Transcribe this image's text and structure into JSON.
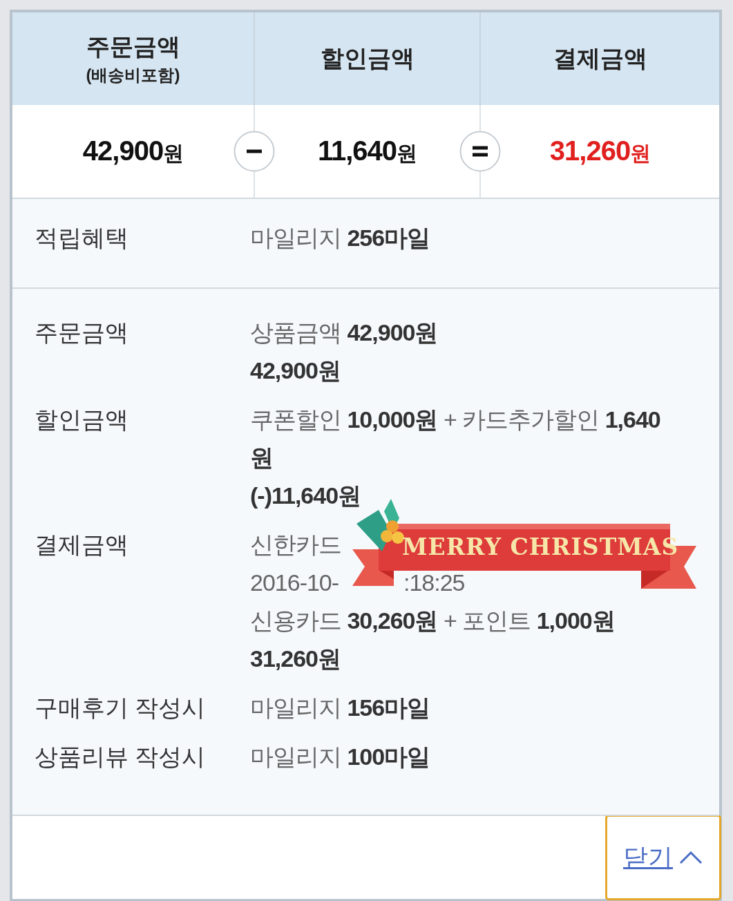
{
  "summary": {
    "columns": [
      {
        "title": "주문금액",
        "subtitle": "(배송비포함)",
        "amount": "42,900",
        "unit": "원",
        "kind": "normal"
      },
      {
        "title": "할인금액",
        "amount": "11,640",
        "unit": "원",
        "kind": "normal"
      },
      {
        "title": "결제금액",
        "amount": "31,260",
        "unit": "원",
        "kind": "total"
      }
    ],
    "operators": [
      {
        "kind": "minus"
      },
      {
        "kind": "equals"
      }
    ]
  },
  "benefit": {
    "label": "적립혜택",
    "lines": [
      "마일리지 **256마일**"
    ]
  },
  "details": [
    {
      "label": "주문금액",
      "lines": [
        "상품금액 **42,900원**",
        "**42,900원**"
      ]
    },
    {
      "label": "할인금액",
      "lines": [
        "쿠폰할인 **10,000원** + 카드추가할인 **1,640원**",
        "**(-)11,640원**"
      ]
    },
    {
      "label": "결제금액",
      "lines": [
        [
          "신한카드"
        ],
        [
          "2016-10-",
          ":18:25"
        ],
        "신용카드 **30,260원** + 포인트 **1,000원**",
        "**31,260원**"
      ]
    },
    {
      "label": "구매후기 작성시",
      "lines": [
        "마일리지 **156마일**"
      ]
    },
    {
      "label": "상품리뷰 작성시",
      "lines": [
        "마일리지 **100마일**"
      ]
    }
  ],
  "banner": {
    "text": "MERRY CHRISTMAS"
  },
  "close_button": {
    "label": "닫기"
  }
}
